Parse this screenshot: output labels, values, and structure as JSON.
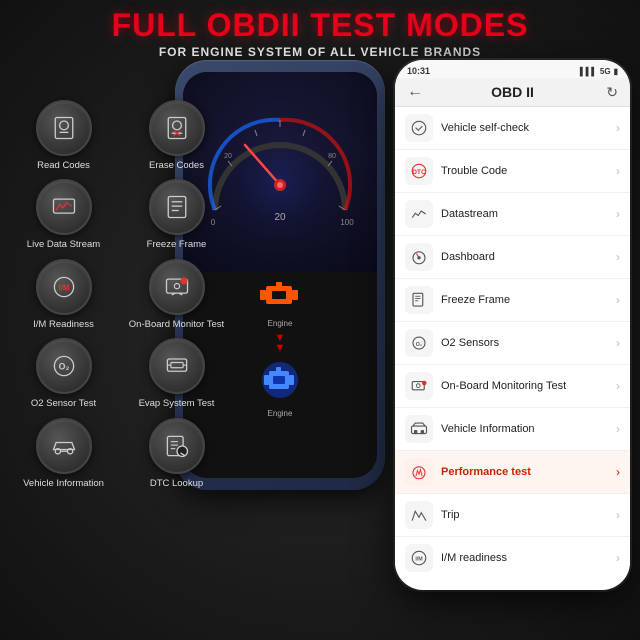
{
  "header": {
    "title": "FULL OBDII TEST MODES",
    "subtitle": "FOR ENGINE SYSTEM OF ALL VEHICLE BRANDS"
  },
  "icons": [
    {
      "label": "Read Codes",
      "icon": "read"
    },
    {
      "label": "Erase Codes",
      "icon": "erase"
    },
    {
      "label": "Live Data Stream",
      "icon": "stream"
    },
    {
      "label": "Freeze Frame",
      "icon": "freeze"
    },
    {
      "label": "I/M Readiness",
      "icon": "readiness"
    },
    {
      "label": "On-Board Monitor Test",
      "icon": "monitor"
    },
    {
      "label": "O2 Sensor Test",
      "icon": "o2"
    },
    {
      "label": "Evap System Test",
      "icon": "evap"
    },
    {
      "label": "Vehicle Information",
      "icon": "vehicle"
    },
    {
      "label": "DTC Lookup",
      "icon": "dtc"
    }
  ],
  "phone_screen": {
    "engine_labels": [
      "Engine",
      "Engine"
    ]
  },
  "app": {
    "status_time": "10:31",
    "status_network": "5G",
    "nav_title": "OBD II",
    "back_icon": "←",
    "refresh_icon": "↻",
    "menu_items": [
      {
        "label": "Vehicle self-check",
        "icon": "check"
      },
      {
        "label": "Trouble Code",
        "icon": "dtc"
      },
      {
        "label": "Datastream",
        "icon": "chart"
      },
      {
        "label": "Dashboard",
        "icon": "dash"
      },
      {
        "label": "Freeze Frame",
        "icon": "freeze"
      },
      {
        "label": "O2 Sensors",
        "icon": "o2"
      },
      {
        "label": "On-Board Monitoring Test",
        "icon": "monitor"
      },
      {
        "label": "Vehicle Information",
        "icon": "vehicle"
      },
      {
        "label": "Performance test",
        "icon": "perf",
        "highlight": true
      },
      {
        "label": "Trip",
        "icon": "trip"
      },
      {
        "label": "I/M readiness",
        "icon": "readiness"
      }
    ]
  }
}
